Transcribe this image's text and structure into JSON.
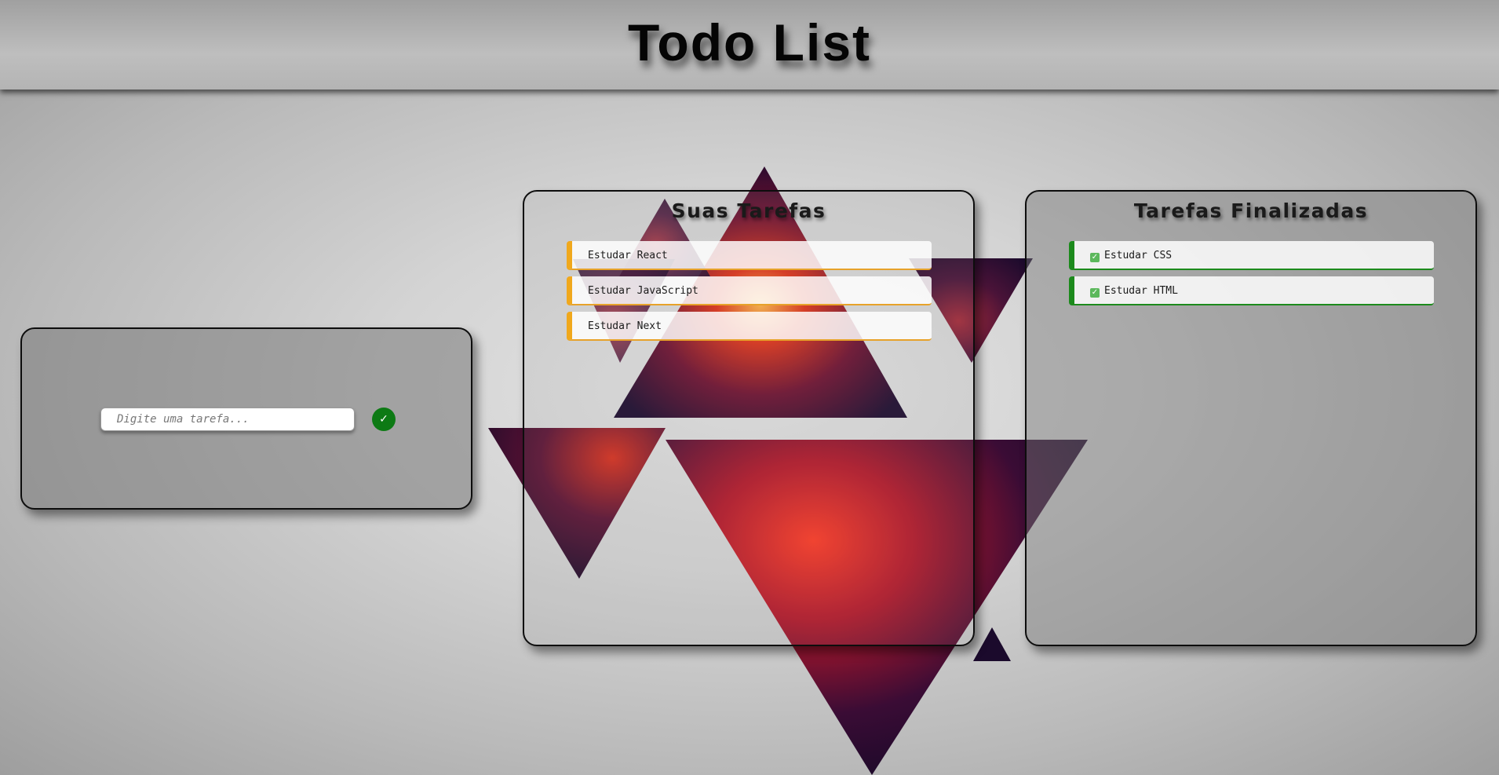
{
  "header": {
    "title": "Todo List"
  },
  "new_task": {
    "placeholder": "Digite uma tarefa...",
    "value": "",
    "submit_icon": "check-icon",
    "submit_glyph": "✓",
    "submit_color": "#0d7a14"
  },
  "pending": {
    "title": "Suas Tarefas",
    "accent_color": "#f0a81c",
    "items": [
      {
        "label": "Estudar React"
      },
      {
        "label": "Estudar JavaScript"
      },
      {
        "label": "Estudar Next"
      }
    ]
  },
  "finished": {
    "title": "Tarefas Finalizadas",
    "accent_color": "#1c8a1c",
    "item_icon": "check-box-icon",
    "item_glyph": "✓",
    "items": [
      {
        "label": "Estudar CSS"
      },
      {
        "label": "Estudar HTML"
      }
    ]
  }
}
